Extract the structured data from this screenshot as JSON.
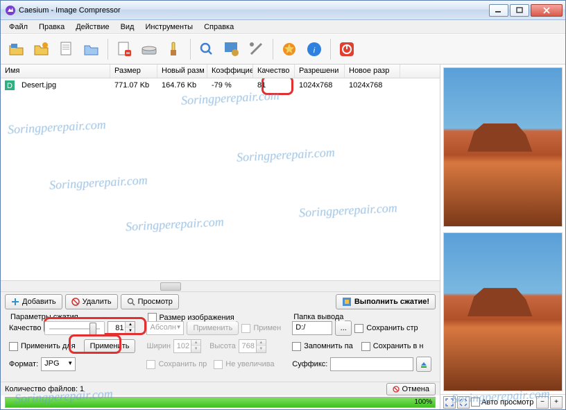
{
  "title": "Caesium - Image Compressor",
  "menu": [
    "Файл",
    "Правка",
    "Действие",
    "Вид",
    "Инструменты",
    "Справка"
  ],
  "cols": [
    "Имя",
    "Размер",
    "Новый разм",
    "Коэффицие",
    "Качество",
    "Разрешени",
    "Новое разр"
  ],
  "row": {
    "name": "Desert.jpg",
    "size": "771.07 Kb",
    "newsize": "164.76 Kb",
    "ratio": "-79 %",
    "quality": "81",
    "res": "1024x768",
    "newres": "1024x768"
  },
  "btns": {
    "add": "Добавить",
    "del": "Удалить",
    "view": "Просмотр",
    "compress": "Выполнить сжатие!"
  },
  "p1": {
    "title": "Параметры сжатия",
    "quality": "Качество",
    "qval": "81",
    "applyfor": "Применить для",
    "apply": "Применить",
    "format": "Формат:",
    "fval": "JPG"
  },
  "p2": {
    "title": "Размер изображения",
    "absol": "Абсолн",
    "applybtn": "Применить",
    "applychk": "Примен",
    "width": "Ширин",
    "wval": "102",
    "height": "Высота",
    "hval": "768",
    "keep": "Сохранить пр",
    "noenl": "Не увеличива"
  },
  "p3": {
    "title": "Папка вывода",
    "path": "D:/",
    "savestr": "Сохранить стр",
    "remember": "Запомнить па",
    "savein": "Сохранить в н",
    "suffix": "Суффикс:",
    "sval": ""
  },
  "status": {
    "count": "Количество файлов: 1",
    "cancel": "Отмена",
    "pct": "100%"
  },
  "rb": {
    "auto": "Авто просмотр"
  },
  "watermark": "Soringperepair.com"
}
